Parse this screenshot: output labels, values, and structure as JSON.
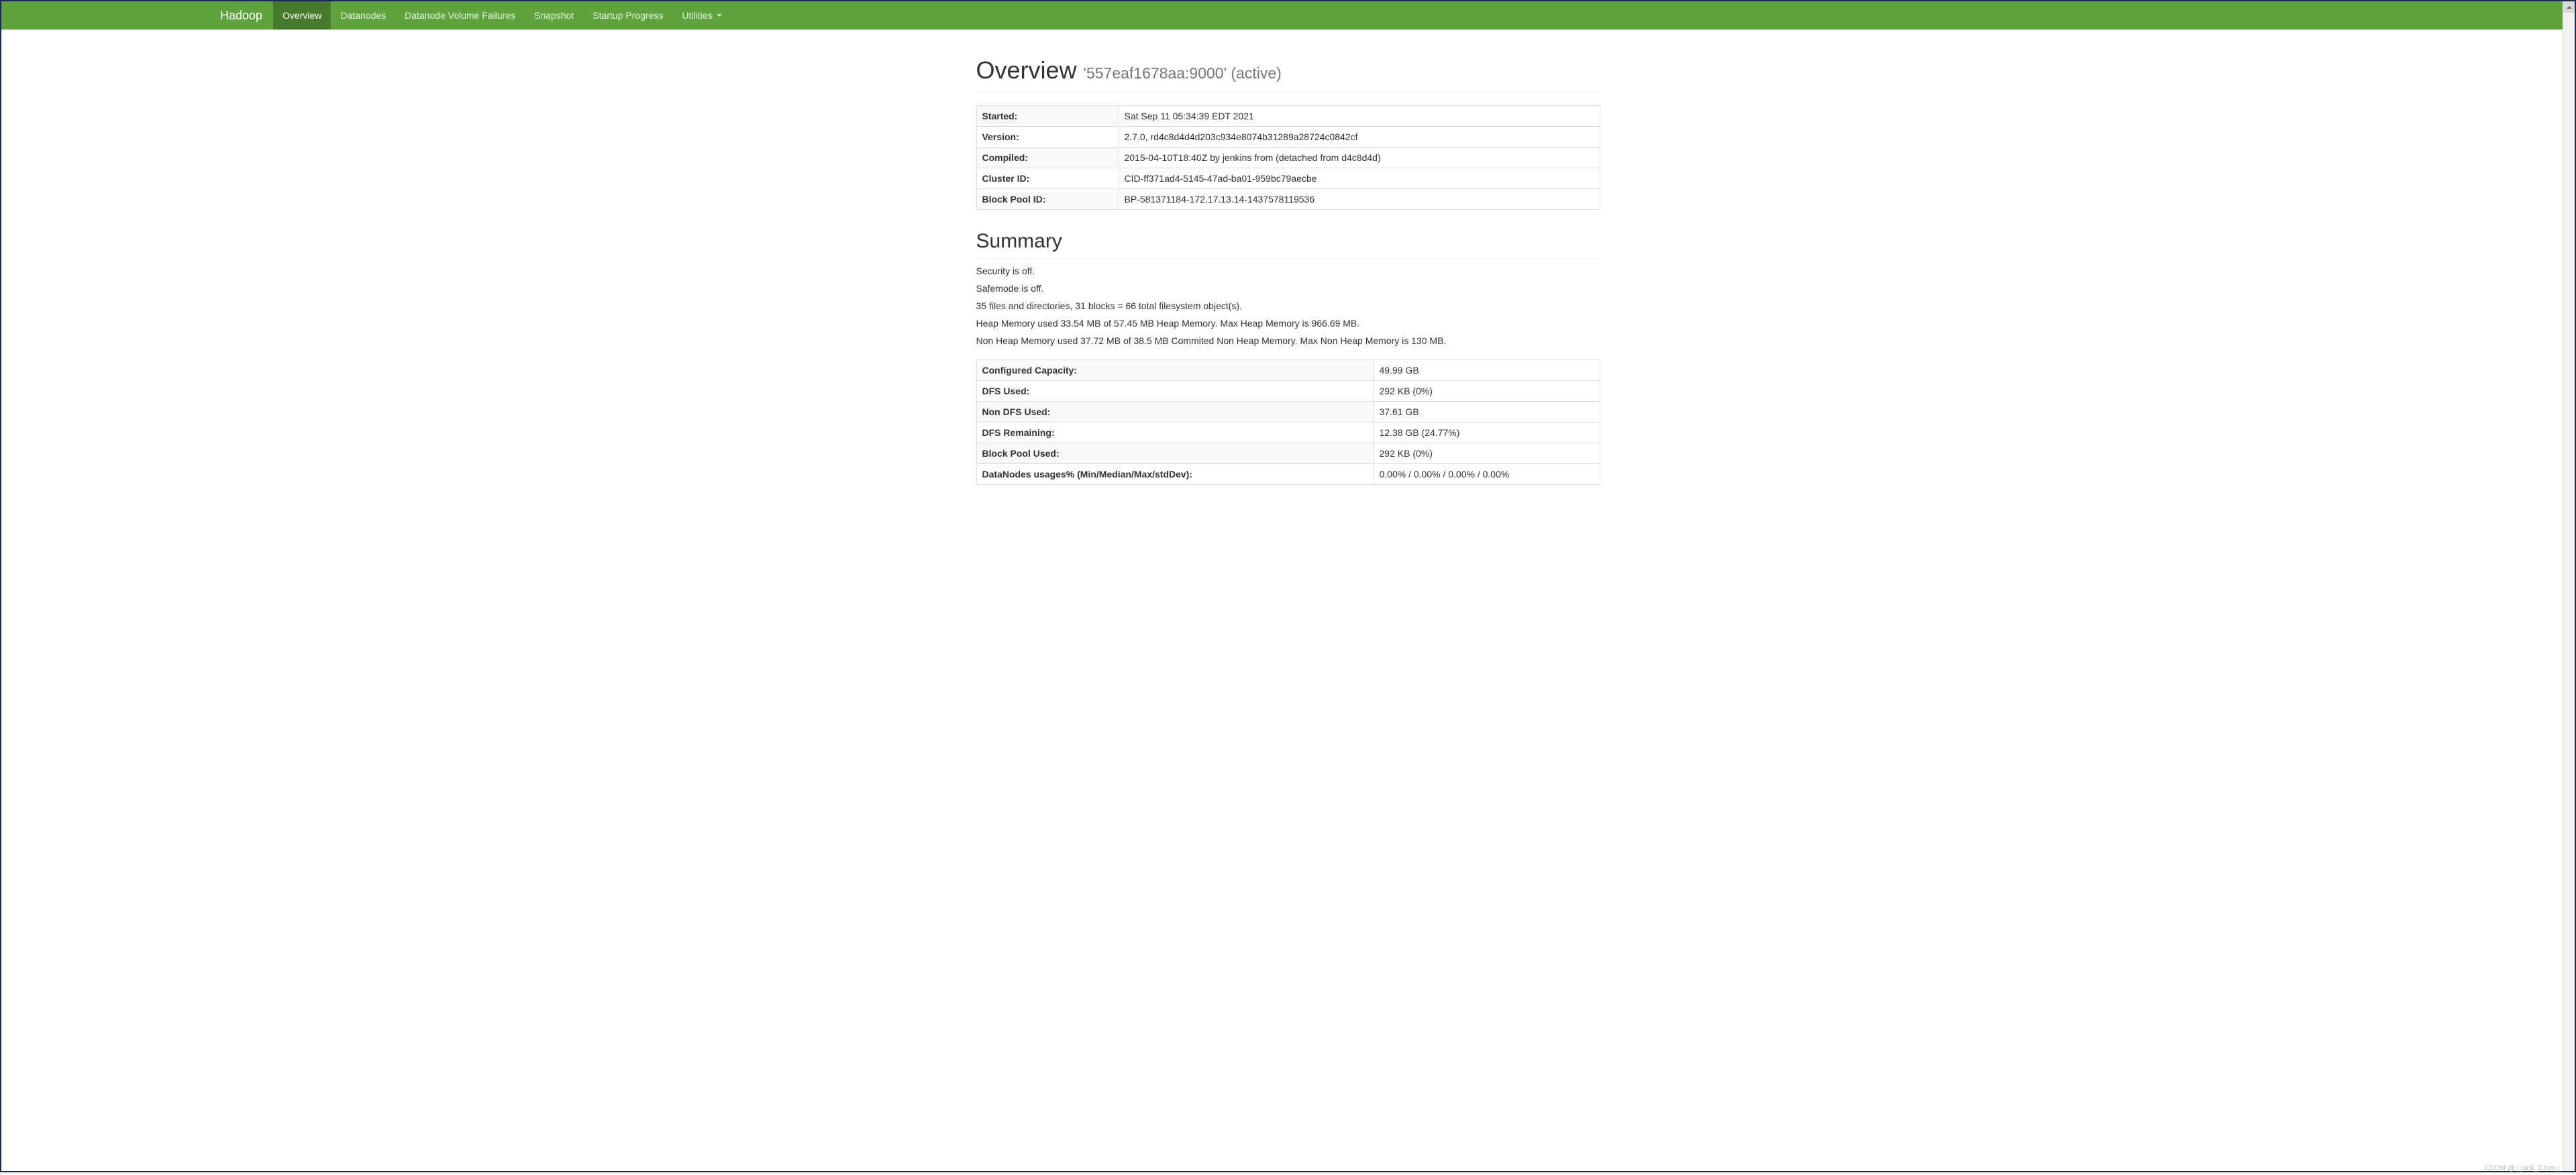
{
  "nav": {
    "brand": "Hadoop",
    "items": [
      {
        "label": "Overview",
        "active": true
      },
      {
        "label": "Datanodes"
      },
      {
        "label": "Datanode Volume Failures"
      },
      {
        "label": "Snapshot"
      },
      {
        "label": "Startup Progress"
      },
      {
        "label": "Utilities",
        "dropdown": true
      }
    ]
  },
  "overview": {
    "title": "Overview",
    "subtitle": "'557eaf1678aa:9000' (active)",
    "rows": [
      {
        "key": "Started:",
        "value": "Sat Sep 11 05:34:39 EDT 2021"
      },
      {
        "key": "Version:",
        "value": "2.7.0, rd4c8d4d4d203c934e8074b31289a28724c0842cf"
      },
      {
        "key": "Compiled:",
        "value": "2015-04-10T18:40Z by jenkins from (detached from d4c8d4d)"
      },
      {
        "key": "Cluster ID:",
        "value": "CID-ff371ad4-5145-47ad-ba01-959bc79aecbe"
      },
      {
        "key": "Block Pool ID:",
        "value": "BP-581371184-172.17.13.14-1437578119536"
      }
    ]
  },
  "summary": {
    "title": "Summary",
    "lines": [
      "Security is off.",
      "Safemode is off.",
      "35 files and directories, 31 blocks = 66 total filesystem object(s).",
      "Heap Memory used 33.54 MB of 57.45 MB Heap Memory. Max Heap Memory is 966.69 MB.",
      "Non Heap Memory used 37.72 MB of 38.5 MB Commited Non Heap Memory. Max Non Heap Memory is 130 MB."
    ],
    "rows": [
      {
        "key": "Configured Capacity:",
        "value": "49.99 GB"
      },
      {
        "key": "DFS Used:",
        "value": "292 KB (0%)"
      },
      {
        "key": "Non DFS Used:",
        "value": "37.61 GB"
      },
      {
        "key": "DFS Remaining:",
        "value": "12.38 GB (24.77%)"
      },
      {
        "key": "Block Pool Used:",
        "value": "292 KB (0%)"
      },
      {
        "key": "DataNodes usages% (Min/Median/Max/stdDev):",
        "value": "0.00% / 0.00% / 0.00% / 0.00%"
      }
    ]
  },
  "watermark": "CSDN @ | jack_Chen |"
}
